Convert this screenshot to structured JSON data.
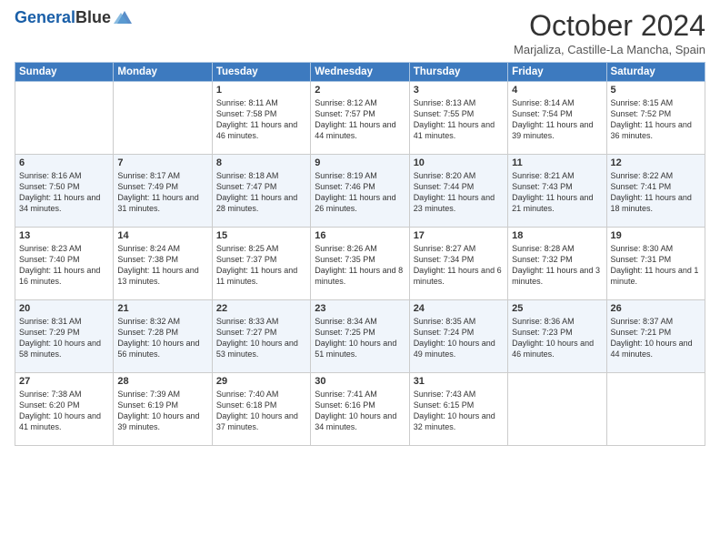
{
  "header": {
    "logo_line1": "General",
    "logo_line2": "Blue",
    "month": "October 2024",
    "location": "Marjaliza, Castille-La Mancha, Spain"
  },
  "days_of_week": [
    "Sunday",
    "Monday",
    "Tuesday",
    "Wednesday",
    "Thursday",
    "Friday",
    "Saturday"
  ],
  "weeks": [
    [
      {
        "day": "",
        "info": ""
      },
      {
        "day": "",
        "info": ""
      },
      {
        "day": "1",
        "info": "Sunrise: 8:11 AM\nSunset: 7:58 PM\nDaylight: 11 hours and 46 minutes."
      },
      {
        "day": "2",
        "info": "Sunrise: 8:12 AM\nSunset: 7:57 PM\nDaylight: 11 hours and 44 minutes."
      },
      {
        "day": "3",
        "info": "Sunrise: 8:13 AM\nSunset: 7:55 PM\nDaylight: 11 hours and 41 minutes."
      },
      {
        "day": "4",
        "info": "Sunrise: 8:14 AM\nSunset: 7:54 PM\nDaylight: 11 hours and 39 minutes."
      },
      {
        "day": "5",
        "info": "Sunrise: 8:15 AM\nSunset: 7:52 PM\nDaylight: 11 hours and 36 minutes."
      }
    ],
    [
      {
        "day": "6",
        "info": "Sunrise: 8:16 AM\nSunset: 7:50 PM\nDaylight: 11 hours and 34 minutes."
      },
      {
        "day": "7",
        "info": "Sunrise: 8:17 AM\nSunset: 7:49 PM\nDaylight: 11 hours and 31 minutes."
      },
      {
        "day": "8",
        "info": "Sunrise: 8:18 AM\nSunset: 7:47 PM\nDaylight: 11 hours and 28 minutes."
      },
      {
        "day": "9",
        "info": "Sunrise: 8:19 AM\nSunset: 7:46 PM\nDaylight: 11 hours and 26 minutes."
      },
      {
        "day": "10",
        "info": "Sunrise: 8:20 AM\nSunset: 7:44 PM\nDaylight: 11 hours and 23 minutes."
      },
      {
        "day": "11",
        "info": "Sunrise: 8:21 AM\nSunset: 7:43 PM\nDaylight: 11 hours and 21 minutes."
      },
      {
        "day": "12",
        "info": "Sunrise: 8:22 AM\nSunset: 7:41 PM\nDaylight: 11 hours and 18 minutes."
      }
    ],
    [
      {
        "day": "13",
        "info": "Sunrise: 8:23 AM\nSunset: 7:40 PM\nDaylight: 11 hours and 16 minutes."
      },
      {
        "day": "14",
        "info": "Sunrise: 8:24 AM\nSunset: 7:38 PM\nDaylight: 11 hours and 13 minutes."
      },
      {
        "day": "15",
        "info": "Sunrise: 8:25 AM\nSunset: 7:37 PM\nDaylight: 11 hours and 11 minutes."
      },
      {
        "day": "16",
        "info": "Sunrise: 8:26 AM\nSunset: 7:35 PM\nDaylight: 11 hours and 8 minutes."
      },
      {
        "day": "17",
        "info": "Sunrise: 8:27 AM\nSunset: 7:34 PM\nDaylight: 11 hours and 6 minutes."
      },
      {
        "day": "18",
        "info": "Sunrise: 8:28 AM\nSunset: 7:32 PM\nDaylight: 11 hours and 3 minutes."
      },
      {
        "day": "19",
        "info": "Sunrise: 8:30 AM\nSunset: 7:31 PM\nDaylight: 11 hours and 1 minute."
      }
    ],
    [
      {
        "day": "20",
        "info": "Sunrise: 8:31 AM\nSunset: 7:29 PM\nDaylight: 10 hours and 58 minutes."
      },
      {
        "day": "21",
        "info": "Sunrise: 8:32 AM\nSunset: 7:28 PM\nDaylight: 10 hours and 56 minutes."
      },
      {
        "day": "22",
        "info": "Sunrise: 8:33 AM\nSunset: 7:27 PM\nDaylight: 10 hours and 53 minutes."
      },
      {
        "day": "23",
        "info": "Sunrise: 8:34 AM\nSunset: 7:25 PM\nDaylight: 10 hours and 51 minutes."
      },
      {
        "day": "24",
        "info": "Sunrise: 8:35 AM\nSunset: 7:24 PM\nDaylight: 10 hours and 49 minutes."
      },
      {
        "day": "25",
        "info": "Sunrise: 8:36 AM\nSunset: 7:23 PM\nDaylight: 10 hours and 46 minutes."
      },
      {
        "day": "26",
        "info": "Sunrise: 8:37 AM\nSunset: 7:21 PM\nDaylight: 10 hours and 44 minutes."
      }
    ],
    [
      {
        "day": "27",
        "info": "Sunrise: 7:38 AM\nSunset: 6:20 PM\nDaylight: 10 hours and 41 minutes."
      },
      {
        "day": "28",
        "info": "Sunrise: 7:39 AM\nSunset: 6:19 PM\nDaylight: 10 hours and 39 minutes."
      },
      {
        "day": "29",
        "info": "Sunrise: 7:40 AM\nSunset: 6:18 PM\nDaylight: 10 hours and 37 minutes."
      },
      {
        "day": "30",
        "info": "Sunrise: 7:41 AM\nSunset: 6:16 PM\nDaylight: 10 hours and 34 minutes."
      },
      {
        "day": "31",
        "info": "Sunrise: 7:43 AM\nSunset: 6:15 PM\nDaylight: 10 hours and 32 minutes."
      },
      {
        "day": "",
        "info": ""
      },
      {
        "day": "",
        "info": ""
      }
    ]
  ]
}
